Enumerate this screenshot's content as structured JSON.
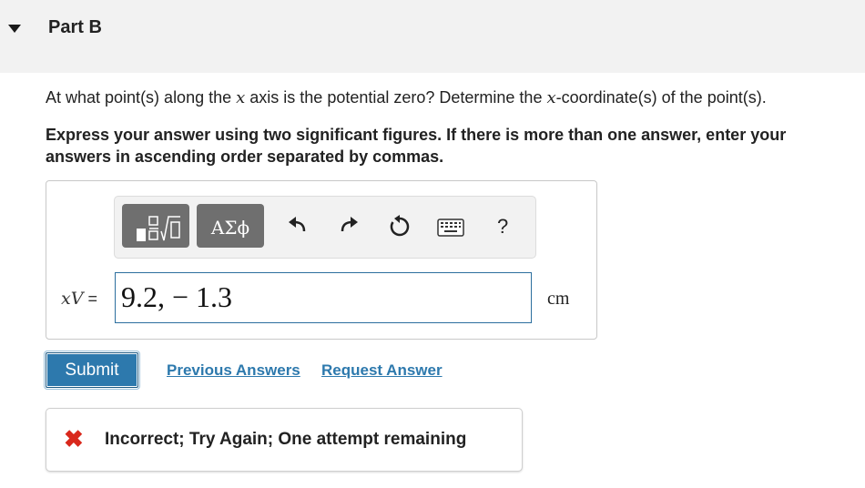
{
  "part": {
    "title": "Part B"
  },
  "question": {
    "text_before": "At what point(s) along the ",
    "var": "x",
    "text_middle": " axis is the potential zero? Determine the ",
    "var2": "x",
    "text_after": "-coordinate(s) of the point(s)."
  },
  "instructions": "Express your answer using two significant figures. If there is more than one answer, enter your answers in ascending order separated by commas.",
  "toolbar": {
    "greek_label": "ΑΣϕ",
    "help_label": "?",
    "icons": [
      "templates-icon",
      "greek-letters-icon",
      "undo-icon",
      "redo-icon",
      "reset-icon",
      "keyboard-icon",
      "help-icon"
    ]
  },
  "answer": {
    "variable_label": "xV",
    "equals": " =",
    "value": "9.2, − 1.3",
    "unit": "cm"
  },
  "actions": {
    "submit_label": "Submit",
    "previous_answers_label": "Previous Answers",
    "request_answer_label": "Request Answer"
  },
  "feedback": {
    "icon": "cross-icon",
    "text": "Incorrect; Try Again; One attempt remaining",
    "color": "#d9281c"
  },
  "colors": {
    "accent": "#2d79ad",
    "header_bg": "#f2f2f2",
    "toolbar_button": "#6f6f6f"
  }
}
